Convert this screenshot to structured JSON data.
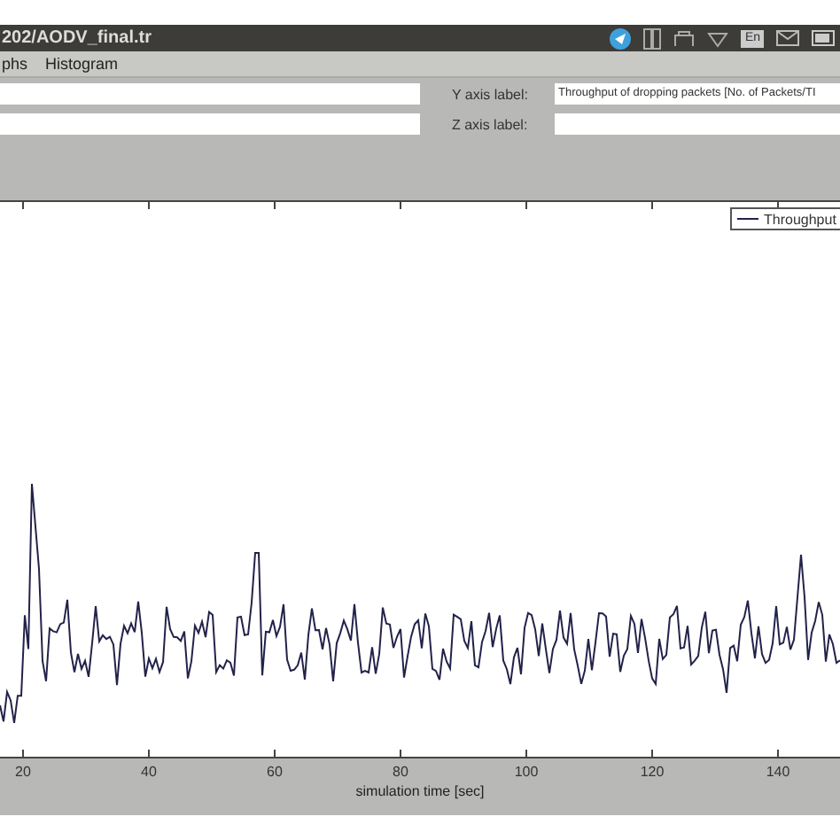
{
  "window": {
    "title": "202/AODV_final.tr",
    "tray_language": "En"
  },
  "menu": [
    "phs",
    "Histogram"
  ],
  "form": {
    "fields": [
      {
        "label": "Y axis label:",
        "value": "Throughput of dropping packets [No. of Packets/TI"
      },
      {
        "label": "Z axis label:"
      }
    ]
  },
  "plot": {
    "legend": "Throughput",
    "xlabel": "simulation time [sec]",
    "xticks": [
      "20",
      "40",
      "60",
      "80",
      "100",
      "120",
      "140"
    ]
  }
}
